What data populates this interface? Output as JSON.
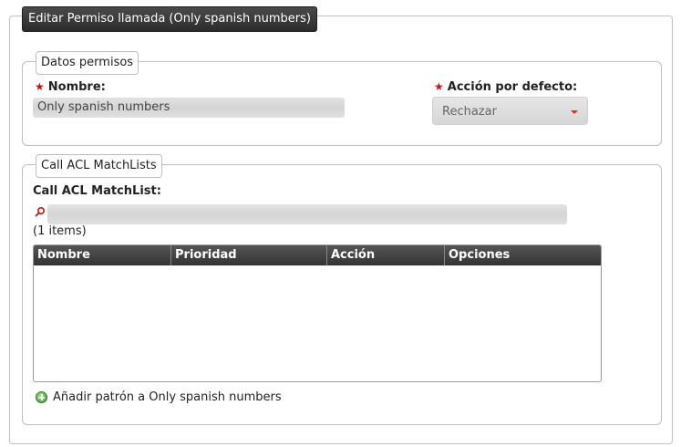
{
  "panel": {
    "title": "Editar Permiso llamada (Only spanish numbers)"
  },
  "datos": {
    "legend": "Datos permisos",
    "nombre_label": "Nombre:",
    "nombre_value": "Only spanish numbers",
    "accion_label": "Acción por defecto:",
    "accion_value": "Rechazar"
  },
  "matchlists": {
    "legend": "Call ACL MatchLists",
    "label": "Call ACL MatchList:",
    "search_value": "",
    "count": "(1 items)",
    "columns": [
      "Nombre",
      "Prioridad",
      "Acción",
      "Opciones"
    ],
    "add_link": "Añadir patrón a Only spanish numbers"
  },
  "colors": {
    "header_bg": "#333333",
    "required_star": "#cc1111",
    "add_icon": "#3e9a2c"
  },
  "icons": {
    "required": "star-icon",
    "search": "search-icon",
    "add": "add-icon"
  }
}
